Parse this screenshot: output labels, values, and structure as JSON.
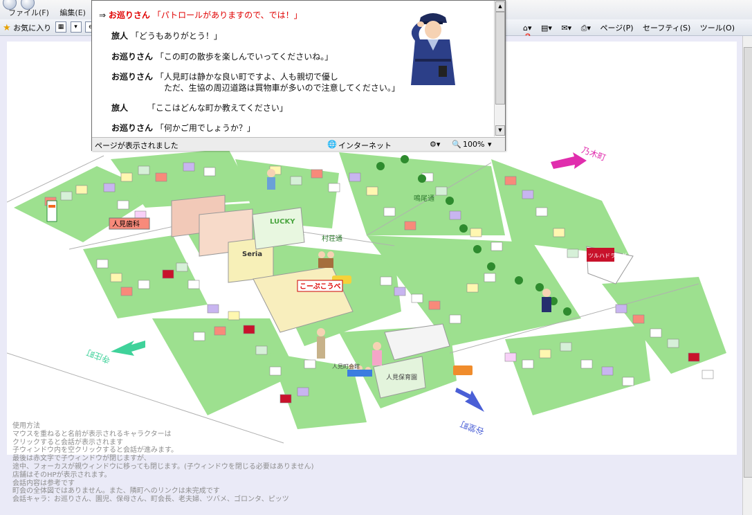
{
  "browser": {
    "menu": [
      "ファイル(F)",
      "編集(E)",
      "表示"
    ],
    "favorites_label": "お気に入り",
    "tools": [
      "ページ(P)",
      "セーフティ(S)",
      "ツール(O)"
    ]
  },
  "popup": {
    "lines": [
      {
        "prefix": "⇒",
        "speaker": "お巡りさん",
        "text": "「パトロールがありますので、では！」"
      },
      {
        "speaker": "旅人",
        "text": "「どうもありがとう！」"
      },
      {
        "speaker": "お巡りさん",
        "text": "「この町の散歩を楽しんでいってくださいね。」"
      },
      {
        "speaker": "お巡りさん",
        "text": "「人見町は静かな良い町ですよ、人も親切で優し"
      },
      {
        "text": "ただ、生協の周辺道路は買物車が多いので注意してください。」"
      },
      {
        "speaker": "旅人",
        "text": "「ここはどんな町か教えてください」"
      },
      {
        "speaker": "お巡りさん",
        "text": "「何かご用でしょうか？」"
      }
    ],
    "status": {
      "text": "ページが表示されました",
      "zone": "インターネット",
      "zoom": "100%"
    }
  },
  "map": {
    "labels": {
      "dentist": "人見歯科",
      "seria": "Seria",
      "lucky": "LUCKY",
      "coop": "こーぷこうべ",
      "street": "村荘通",
      "street2": "鳴尾通",
      "drug": "ツルハドラッグ",
      "nursery": "人見保育園",
      "community": "人見町会館",
      "to_north": "乃木町",
      "to_west": "寺庄町",
      "to_south": "谷堂町"
    }
  },
  "usage": {
    "lines": [
      "使用方法",
      "マウスを重ねると名前が表示されるキャラクターは",
      "クリックすると会話が表示されます",
      "子ウィンドウ内を空クリックすると会話が進みます。",
      "最後は赤文字で子ウィンドウが閉じますが、",
      "途中、フォーカスが親ウィンドウに移っても閉じます。(子ウィンドウを閉じる必要はありません)",
      "店舗はそのHPが表示されます。",
      "会話内容は参考です",
      "町会の全体図ではありません。また、隣町へのリンクは未完成です",
      "会話キャラ：お巡りさん、園児、保母さん、町会長、老夫婦、ツバメ、ゴロンタ、ピッツ"
    ]
  }
}
